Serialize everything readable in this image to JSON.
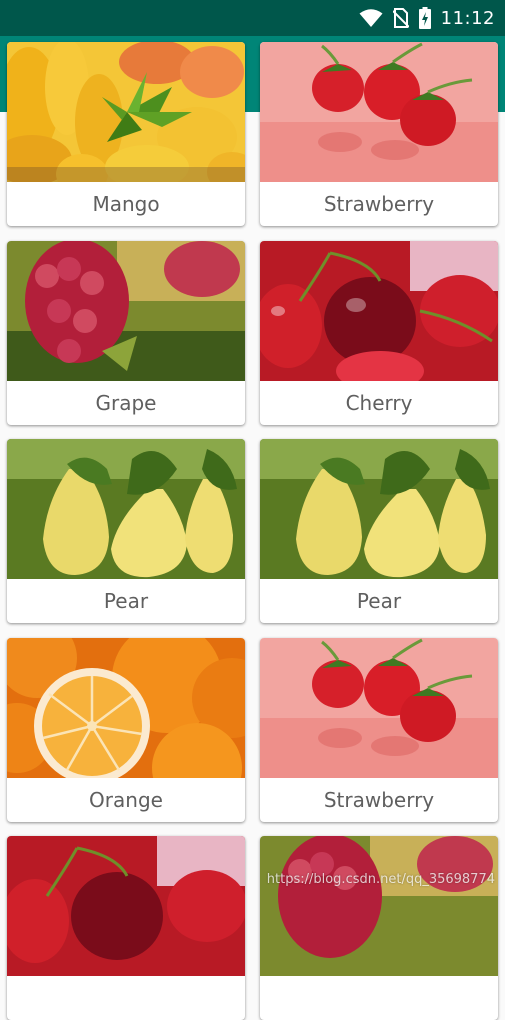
{
  "status_bar": {
    "time": "11:12",
    "icons": [
      "wifi-icon",
      "no-sim-icon",
      "battery-charging-icon"
    ]
  },
  "cards": [
    {
      "label": "Mango",
      "image": "mango-image"
    },
    {
      "label": "Strawberry",
      "image": "strawberry-image"
    },
    {
      "label": "Grape",
      "image": "grape-image"
    },
    {
      "label": "Cherry",
      "image": "cherry-image"
    },
    {
      "label": "Pear",
      "image": "pear-image"
    },
    {
      "label": "Pear",
      "image": "pear-image"
    },
    {
      "label": "Orange",
      "image": "orange-image"
    },
    {
      "label": "Strawberry",
      "image": "strawberry-image"
    },
    {
      "label": "",
      "image": "cherry-image"
    },
    {
      "label": "",
      "image": "grape-image"
    }
  ],
  "watermark": "https://blog.csdn.net/qq_35698774",
  "colors": {
    "status_bar": "#00574b",
    "app_bar": "#008577",
    "label_text": "#5f5f5f"
  }
}
